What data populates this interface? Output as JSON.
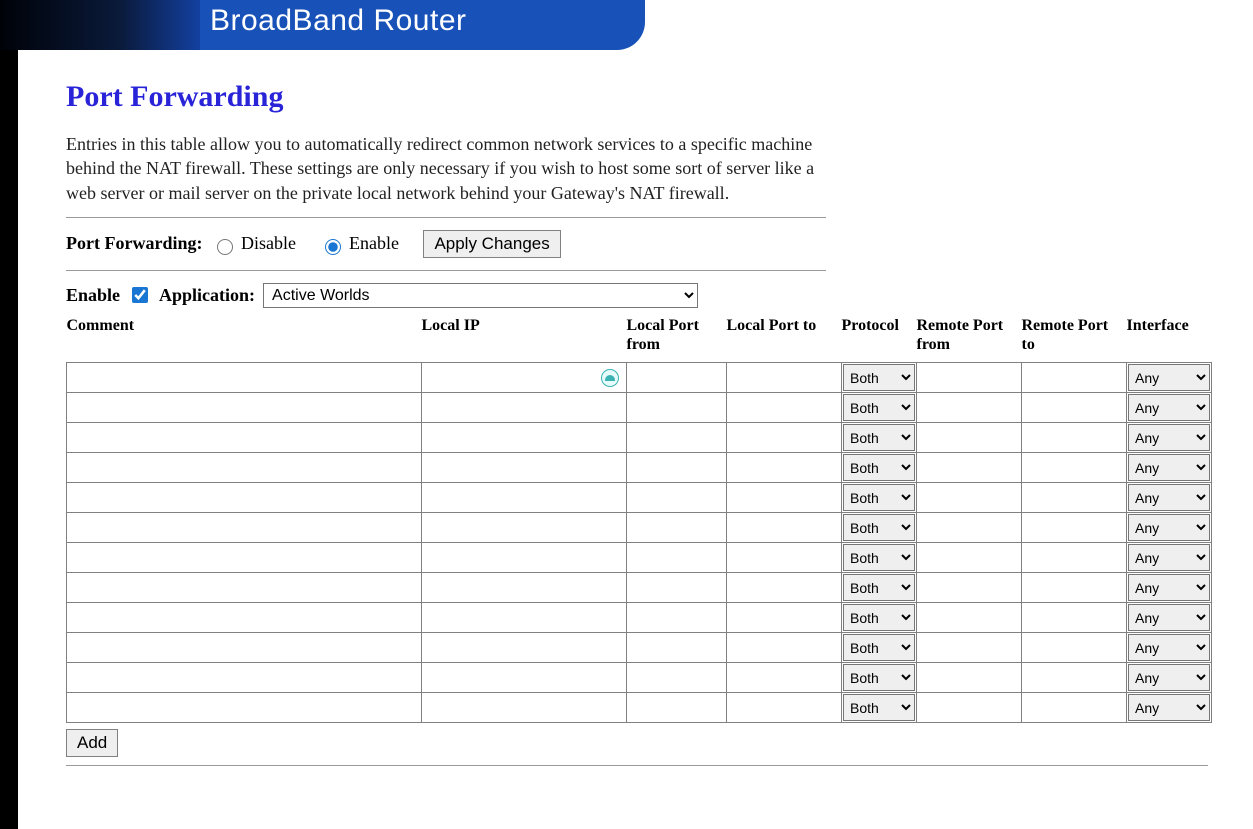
{
  "banner": {
    "title": "BroadBand Router"
  },
  "page": {
    "title": "Port Forwarding",
    "description": "Entries in this table allow you to automatically redirect common network services to a specific machine behind the NAT firewall. These settings are only necessary if you wish to host some sort of server like a web server or mail server on the private local network behind your Gateway's NAT firewall."
  },
  "toggle": {
    "label": "Port Forwarding:",
    "disable_label": "Disable",
    "enable_label": "Enable",
    "selected": "enable",
    "apply_label": "Apply Changes"
  },
  "app_row": {
    "enable_label": "Enable",
    "enable_checked": true,
    "application_label": "Application:",
    "application_selected": "Active Worlds"
  },
  "table": {
    "headers": {
      "comment": "Comment",
      "local_ip": "Local IP",
      "local_port_from": "Local Port from",
      "local_port_to": "Local Port to",
      "protocol": "Protocol",
      "remote_port_from": "Remote Port from",
      "remote_port_to": "Remote Port to",
      "interface": "Interface"
    },
    "protocol_value": "Both",
    "interface_value": "Any",
    "row_count": 12
  },
  "add_button": "Add"
}
